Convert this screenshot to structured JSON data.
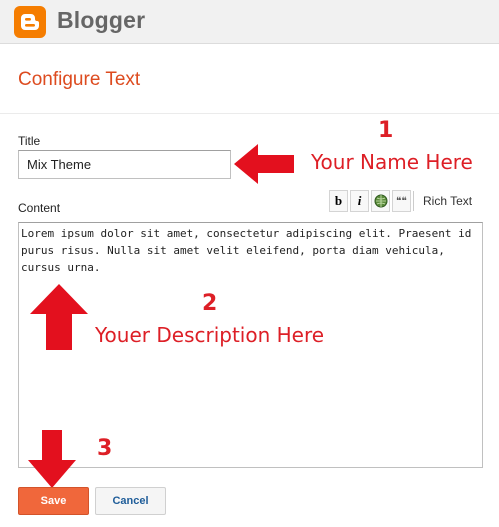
{
  "header": {
    "brand": "Blogger",
    "logo_icon": "blogger-logo-icon",
    "brand_color": "#f57d00"
  },
  "page": {
    "title": "Configure Text"
  },
  "form": {
    "title_label": "Title",
    "title_value": "Mix Theme",
    "content_label": "Content",
    "content_value": "Lorem ipsum dolor sit amet, consectetur adipiscing elit. Praesent id purus risus. Nulla sit amet velit eleifend, porta diam vehicula, cursus urna.",
    "toolbar": {
      "bold_label": "b",
      "italic_label": "i",
      "link_icon": "link-globe-icon",
      "quote_label": "❝❝",
      "rich_text_label": "Rich Text"
    }
  },
  "annotations": {
    "step1_number": "1",
    "step1_text": "Your Name Here",
    "step2_number": "2",
    "step2_text": "Youer Description Here",
    "step3_number": "3",
    "color": "#dd1f26"
  },
  "actions": {
    "save_label": "Save",
    "cancel_label": "Cancel",
    "accent": "#f0673b"
  }
}
